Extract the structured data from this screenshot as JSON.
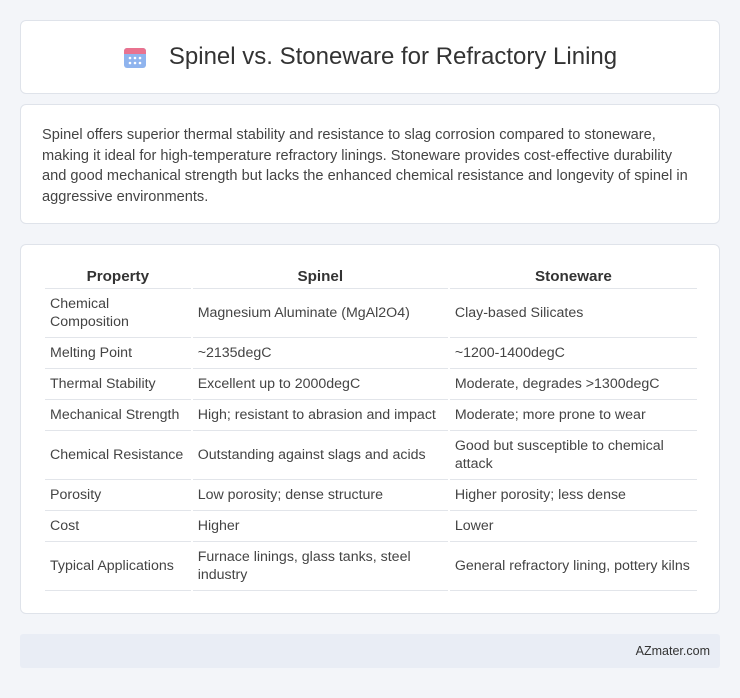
{
  "header": {
    "title": "Spinel vs. Stoneware for Refractory Lining",
    "icon": "calendar-icon",
    "icon_colors": {
      "top": "#e86a8a",
      "body": "#7aa8e8",
      "dots": "#5b8fd9"
    }
  },
  "summary": {
    "text": "Spinel offers superior thermal stability and resistance to slag corrosion compared to stoneware, making it ideal for high-temperature refractory linings. Stoneware provides cost-effective durability and good mechanical strength but lacks the enhanced chemical resistance and longevity of spinel in aggressive environments."
  },
  "table": {
    "headers": [
      "Property",
      "Spinel",
      "Stoneware"
    ],
    "rows": [
      [
        "Chemical Composition",
        "Magnesium Aluminate (MgAl2O4)",
        "Clay-based Silicates"
      ],
      [
        "Melting Point",
        "~2135degC",
        "~1200-1400degC"
      ],
      [
        "Thermal Stability",
        "Excellent up to 2000degC",
        "Moderate, degrades >1300degC"
      ],
      [
        "Mechanical Strength",
        "High; resistant to abrasion and impact",
        "Moderate; more prone to wear"
      ],
      [
        "Chemical Resistance",
        "Outstanding against slags and acids",
        "Good but susceptible to chemical attack"
      ],
      [
        "Porosity",
        "Low porosity; dense structure",
        "Higher porosity; less dense"
      ],
      [
        "Cost",
        "Higher",
        "Lower"
      ],
      [
        "Typical Applications",
        "Furnace linings, glass tanks, steel industry",
        "General refractory lining, pottery kilns"
      ]
    ]
  },
  "footer": {
    "text": "AZmater.com"
  }
}
